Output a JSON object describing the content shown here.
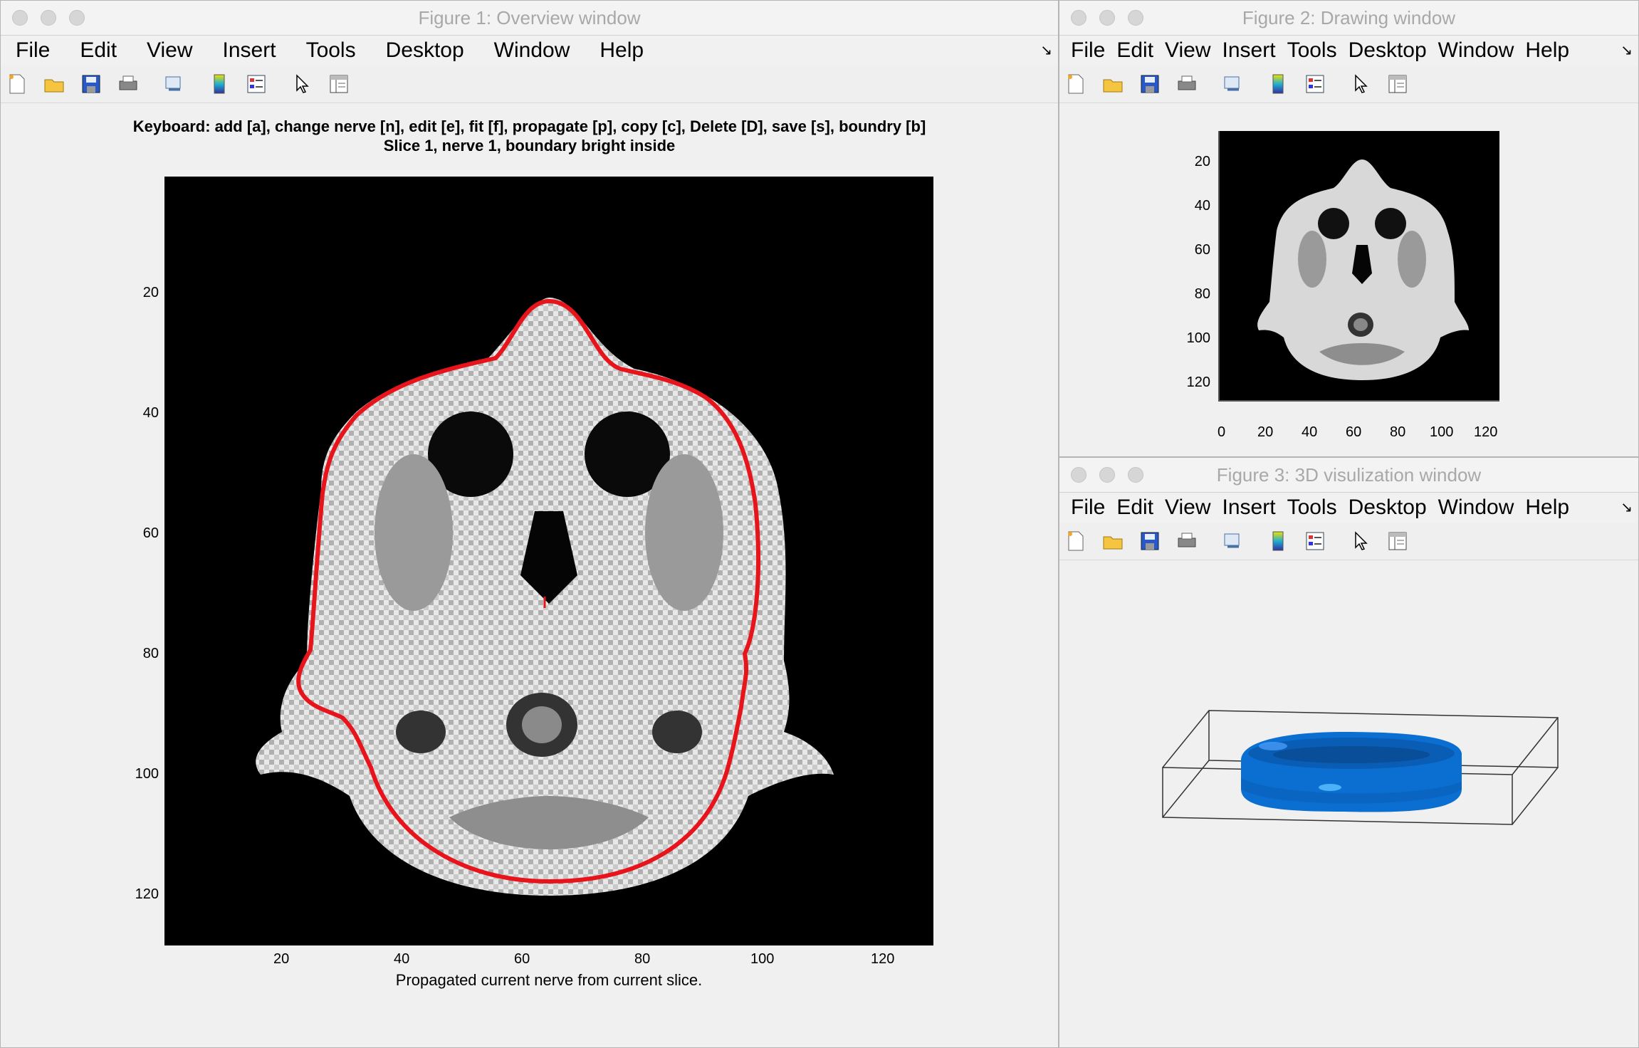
{
  "menu": [
    "File",
    "Edit",
    "View",
    "Insert",
    "Tools",
    "Desktop",
    "Window",
    "Help"
  ],
  "toolbar_icons": [
    "new-figure-icon",
    "open-file-icon",
    "save-icon",
    "print-icon",
    "link-icon",
    "colorbar-icon",
    "legend-icon",
    "pointer-icon",
    "property-editor-icon"
  ],
  "fig1": {
    "title": "Figure 1: Overview window",
    "instructions": "Keyboard: add [a], change nerve [n], edit [e], fit [f], propagate [p], copy [c], Delete [D], save [s], boundry [b]",
    "subtitle": "Slice 1, nerve 1, boundary bright inside",
    "xlabel": "Propagated current nerve from current slice.",
    "xticks": [
      "20",
      "40",
      "60",
      "80",
      "100",
      "120"
    ],
    "yticks": [
      "20",
      "40",
      "60",
      "80",
      "100",
      "120"
    ]
  },
  "fig2": {
    "title": "Figure 2: Drawing window",
    "xticks": [
      "0",
      "20",
      "40",
      "60",
      "80",
      "100",
      "120"
    ],
    "yticks": [
      "20",
      "40",
      "60",
      "80",
      "100",
      "120"
    ]
  },
  "fig3": {
    "title": "Figure 3: 3D visulization window"
  },
  "colors": {
    "contour": "#e8141c",
    "surface": "#0a6fd0",
    "image_bg": "#000000"
  }
}
